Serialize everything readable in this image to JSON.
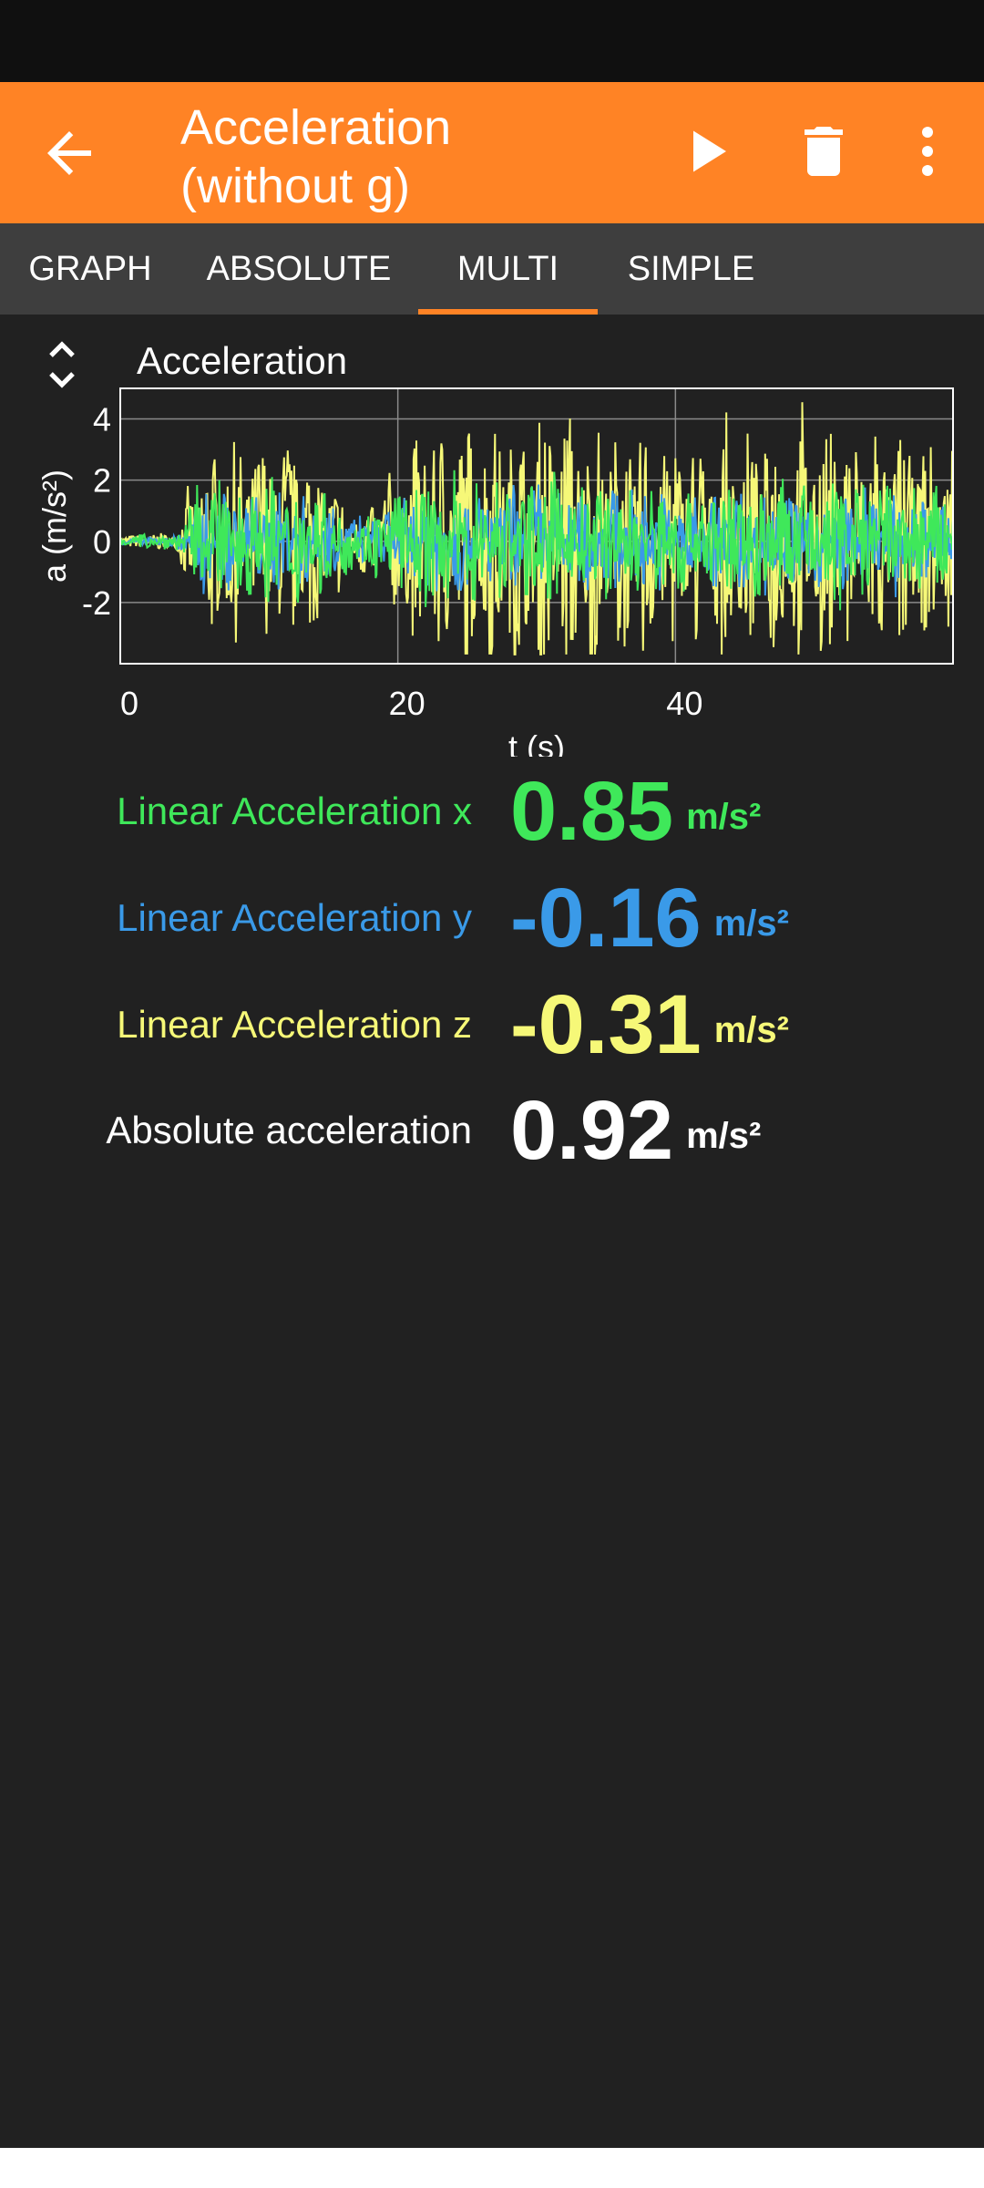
{
  "app_bar": {
    "title": "Acceleration\n(without g)",
    "back_icon": "arrow-left-icon",
    "play_icon": "play-icon",
    "delete_icon": "trash-icon",
    "more_icon": "more-vert-icon",
    "bg_color": "#ff8325"
  },
  "tabs": [
    {
      "label": "GRAPH"
    },
    {
      "label": "ABSOLUTE"
    },
    {
      "label": "MULTI",
      "active": true
    },
    {
      "label": "SIMPLE"
    }
  ],
  "graph": {
    "title": "Acceleration",
    "expand_icon": "expand-collapse-icon"
  },
  "chart_data": {
    "type": "line",
    "title": "Acceleration",
    "xlabel": "t (s)",
    "ylabel": "a (m/s²)",
    "xlim": [
      0,
      60
    ],
    "ylim": [
      -4,
      5
    ],
    "xticks": [
      0,
      20,
      40
    ],
    "yticks": [
      4,
      2,
      0,
      -2
    ],
    "grid": true,
    "legend": "none",
    "series": [
      {
        "color": "#f6f878",
        "envelope": [
          {
            "t": 0,
            "amp": 0.2
          },
          {
            "t": 4,
            "amp": 0.3
          },
          {
            "t": 6,
            "amp": 3.2
          },
          {
            "t": 13,
            "amp": 3.6
          },
          {
            "t": 17,
            "amp": 1.0
          },
          {
            "t": 22,
            "amp": 3.8
          },
          {
            "t": 32,
            "amp": 4.5
          },
          {
            "t": 43,
            "amp": 3.5
          },
          {
            "t": 52,
            "amp": 4.3
          },
          {
            "t": 60,
            "amp": 3.2
          }
        ]
      },
      {
        "color": "#3a9ae8",
        "envelope": [
          {
            "t": 0,
            "amp": 0.1
          },
          {
            "t": 4,
            "amp": 0.2
          },
          {
            "t": 6,
            "amp": 1.8
          },
          {
            "t": 13,
            "amp": 1.6
          },
          {
            "t": 17,
            "amp": 0.8
          },
          {
            "t": 22,
            "amp": 1.8
          },
          {
            "t": 32,
            "amp": 1.8
          },
          {
            "t": 43,
            "amp": 1.7
          },
          {
            "t": 52,
            "amp": 1.6
          },
          {
            "t": 60,
            "amp": 1.4
          }
        ]
      },
      {
        "color": "#3fe85a",
        "envelope": [
          {
            "t": 0,
            "amp": 0.2
          },
          {
            "t": 4,
            "amp": 0.3
          },
          {
            "t": 6,
            "amp": 2.0
          },
          {
            "t": 13,
            "amp": 2.2
          },
          {
            "t": 17,
            "amp": 0.9
          },
          {
            "t": 22,
            "amp": 2.2
          },
          {
            "t": 32,
            "amp": 2.0
          },
          {
            "t": 43,
            "amp": 2.0
          },
          {
            "t": 52,
            "amp": 2.2
          },
          {
            "t": 60,
            "amp": 1.8
          }
        ]
      }
    ]
  },
  "readouts": [
    {
      "label": "Linear Acceleration x",
      "value": "0.85",
      "unit": "m/s²",
      "color": "#3fe85a"
    },
    {
      "label": "Linear Acceleration y",
      "value": "-0.16",
      "unit": "m/s²",
      "color": "#3a9ae8"
    },
    {
      "label": "Linear Acceleration z",
      "value": "-0.31",
      "unit": "m/s²",
      "color": "#f6f878"
    },
    {
      "label": "Absolute acceleration",
      "value": "0.92",
      "unit": "m/s²",
      "color": "#ffffff"
    }
  ]
}
